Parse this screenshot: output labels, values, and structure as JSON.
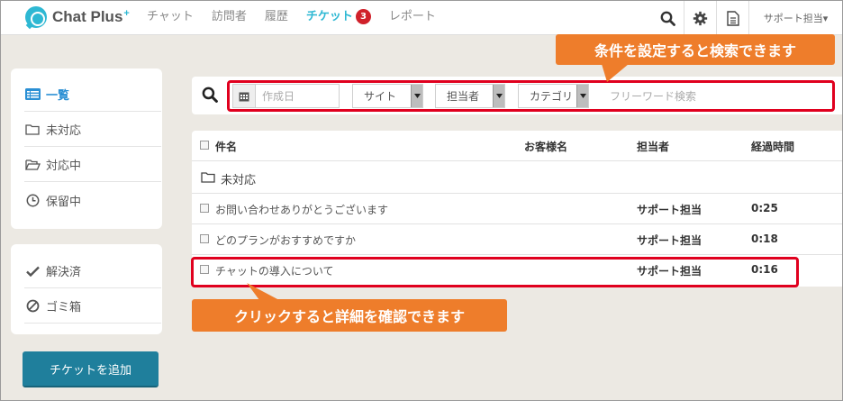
{
  "header": {
    "logo_text": "Chat Plus",
    "logo_sup": "+",
    "nav": [
      "チャット",
      "訪問者",
      "履歴",
      "チケット",
      "レポート"
    ],
    "active_nav": "チケット",
    "ticket_badge": "3",
    "user_menu": "サポート担当▾"
  },
  "sidebar": {
    "items": [
      {
        "label": "一覧",
        "icon": "list-icon",
        "active": true
      },
      {
        "label": "未対応",
        "icon": "folder-icon"
      },
      {
        "label": "対応中",
        "icon": "folder-open-icon"
      },
      {
        "label": "保留中",
        "icon": "clock-icon"
      }
    ],
    "items2": [
      {
        "label": "解決済",
        "icon": "check-icon"
      },
      {
        "label": "ゴミ箱",
        "icon": "ban-icon"
      }
    ],
    "add_button": "チケットを追加"
  },
  "search": {
    "date_placeholder": "作成日",
    "site": "サイト",
    "agent": "担当者",
    "category": "カテゴリ",
    "freeword_placeholder": "フリーワード検索"
  },
  "table": {
    "headers": {
      "subject": "件名",
      "customer": "お客様名",
      "agent": "担当者",
      "elapsed": "経過時間"
    },
    "group": "未対応",
    "rows": [
      {
        "subject": "お問い合わせありがとうございます",
        "customer": "",
        "agent": "サポート担当",
        "elapsed": "0:25"
      },
      {
        "subject": "どのプランがおすすめですか",
        "customer": "",
        "agent": "サポート担当",
        "elapsed": "0:18"
      },
      {
        "subject": "チャットの導入について",
        "customer": "",
        "agent": "サポート担当",
        "elapsed": "0:16"
      }
    ]
  },
  "callouts": {
    "search": "条件を設定すると検索できます",
    "detail": "クリックすると詳細を確認できます"
  },
  "colors": {
    "accent": "#2eb8d3",
    "callout": "#ee7d2b",
    "highlight": "#e0001e",
    "button": "#1f7f9c"
  }
}
